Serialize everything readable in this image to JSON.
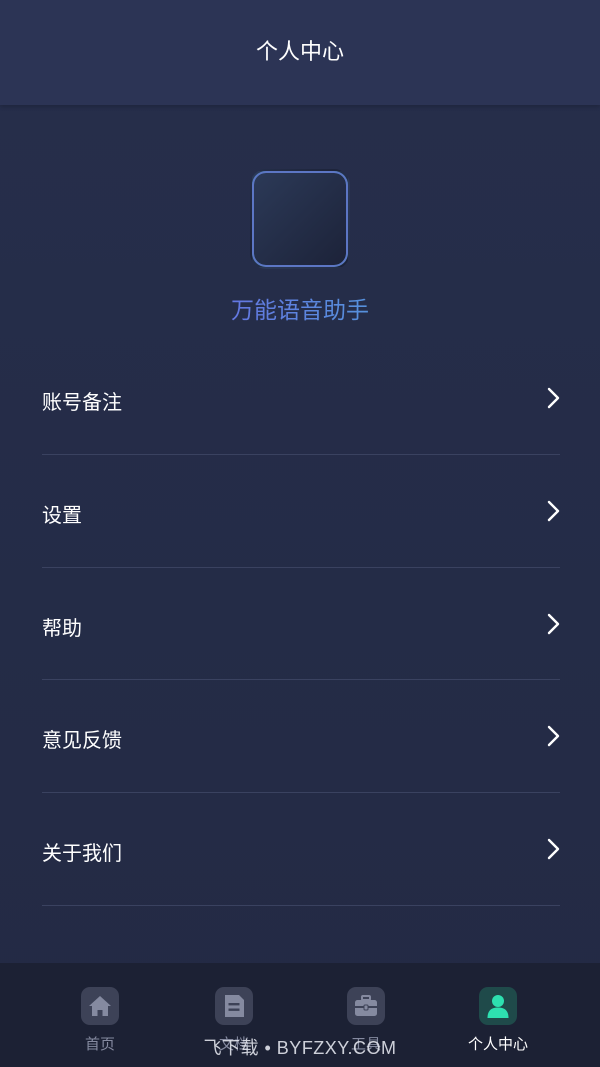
{
  "header": {
    "title": "个人中心"
  },
  "app": {
    "name": "万能语音助手",
    "icon": "sound-wave-icon"
  },
  "menu": {
    "items": [
      {
        "label": "账号备注"
      },
      {
        "label": "设置"
      },
      {
        "label": "帮助"
      },
      {
        "label": "意见反馈"
      },
      {
        "label": "关于我们"
      }
    ]
  },
  "tabs": [
    {
      "label": "首页",
      "icon": "home-icon",
      "active": false
    },
    {
      "label": "文档",
      "icon": "document-icon",
      "active": false
    },
    {
      "label": "工具",
      "icon": "toolbox-icon",
      "active": false
    },
    {
      "label": "个人中心",
      "icon": "user-icon",
      "active": true
    }
  ],
  "watermark": "飞下载 • BYFZXY.COM",
  "colors": {
    "background": "#252c47",
    "header": "#2c3455",
    "tabbar": "#1c2134",
    "accent": "#2ee0b0",
    "app_name_gradient_start": "#6f62e6",
    "app_name_gradient_end": "#4aa6d8"
  }
}
